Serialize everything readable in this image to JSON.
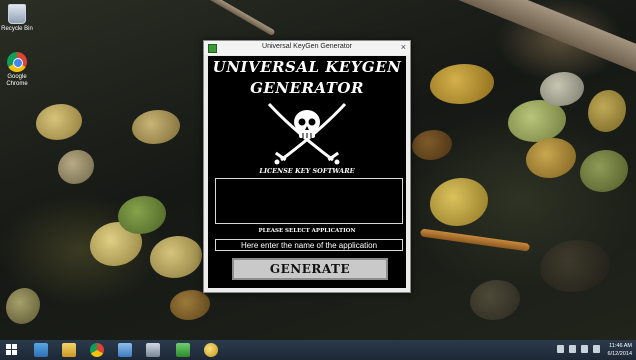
{
  "desktop": {
    "icons": [
      {
        "label": "Recycle Bin",
        "icon": "recycle-bin-icon"
      },
      {
        "label": "Google Chrome",
        "icon": "chrome-icon"
      }
    ]
  },
  "window": {
    "title": "Universal KeyGen Generator",
    "heading_line1": "UNIVERSAL KEYGEN",
    "heading_line2": "GENERATOR",
    "tagline": "LICENSE KEY SOFTWARE",
    "logo_icon": "skull-crossed-swords-icon",
    "output_value": "",
    "select_label": "PLEASE SELECT APPLICATION",
    "app_input_value": "Here enter the name of the application",
    "generate_label": "GENERATE",
    "close_glyph": "×"
  },
  "taskbar": {
    "pinned": [
      "windows-start-icon",
      "ie-icon",
      "file-explorer-icon",
      "chrome-icon",
      "internet-explorer-icon",
      "network-icon",
      "keygen-app-icon",
      "misc-app-icon"
    ],
    "clock_time": "11:46 AM",
    "clock_date": "6/12/2014"
  },
  "colors": {
    "window_client": "#000000",
    "button_face": "#c9c9c9",
    "taskbar": "#1d2836"
  }
}
